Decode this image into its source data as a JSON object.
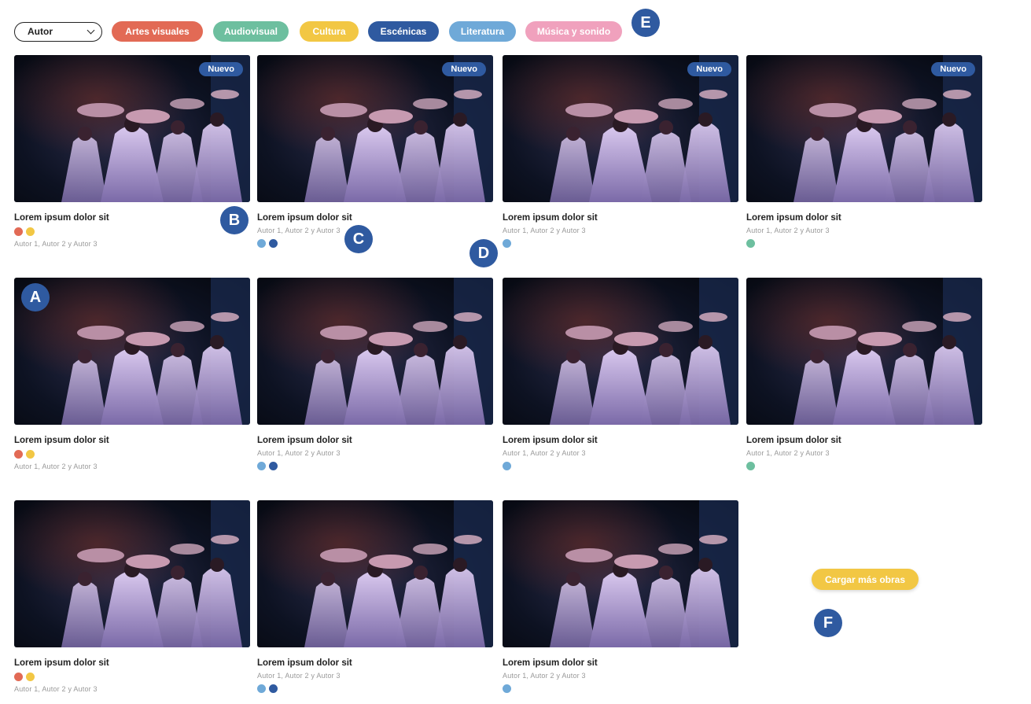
{
  "filters": {
    "select_label": "Autor",
    "chips": [
      {
        "label": "Artes visuales",
        "color": "#e26a55"
      },
      {
        "label": "Audiovisual",
        "color": "#6dbf9f"
      },
      {
        "label": "Cultura",
        "color": "#f2c744"
      },
      {
        "label": "Escénicas",
        "color": "#2f5aa0"
      },
      {
        "label": "Literatura",
        "color": "#6fa9d8"
      },
      {
        "label": "Música y sonido",
        "color": "#f0a1bd"
      }
    ]
  },
  "markers": {
    "a": "A",
    "b": "B",
    "c": "C",
    "d": "D",
    "e": "E",
    "f": "F"
  },
  "badge_label": "Nuevo",
  "cards": [
    {
      "title": "Lorem ipsum dolor sit",
      "authors": "Autor 1, Autor 2 y Autor 3",
      "badge": true
    },
    {
      "title": "Lorem ipsum dolor sit",
      "authors": "Autor 1, Autor 2 y Autor 3",
      "badge": true
    },
    {
      "title": "Lorem ipsum dolor sit",
      "authors": "Autor 1, Autor 2 y Autor 3",
      "badge": true
    },
    {
      "title": "Lorem ipsum dolor sit",
      "authors": "Autor 1, Autor 2 y Autor 3",
      "badge": true
    },
    {
      "title": "Lorem ipsum dolor sit",
      "authors": "Autor 1, Autor 2 y Autor 3",
      "badge": false
    },
    {
      "title": "Lorem ipsum dolor sit",
      "authors": "Autor 1, Autor 2 y Autor 3",
      "badge": false
    },
    {
      "title": "Lorem ipsum dolor sit",
      "authors": "Autor 1, Autor 2 y Autor 3",
      "badge": false
    },
    {
      "title": "Lorem ipsum dolor sit",
      "authors": "Autor 1, Autor 2 y Autor 3",
      "badge": false
    },
    {
      "title": "Lorem ipsum dolor sit",
      "authors": "Autor 1, Autor 2 y Autor 3",
      "badge": false
    },
    {
      "title": "Lorem ipsum dolor sit",
      "authors": "Autor 1, Autor 2 y Autor 3",
      "badge": false
    },
    {
      "title": "Lorem ipsum dolor sit",
      "authors": "Autor 1, Autor 2 y Autor 3",
      "badge": false
    }
  ],
  "category_colors": {
    "artes": "#e26a55",
    "cultura": "#f2c744",
    "literatura": "#6fa9d8",
    "escenicas": "#2f5aa0",
    "audiovisual": "#6dbf9f"
  },
  "load_more_label": "Cargar más obras"
}
